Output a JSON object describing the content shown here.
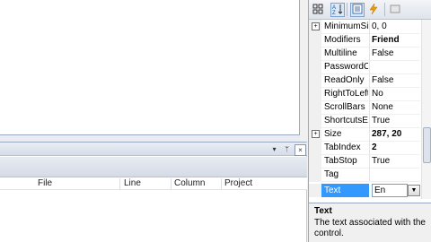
{
  "designer": {},
  "error_list": {
    "columns": [
      "File",
      "Line",
      "Column",
      "Project"
    ],
    "title_buttons": {
      "dropdown": "▾",
      "pin": "ᛘ",
      "close": "×"
    }
  },
  "properties": {
    "toolbar_icons": [
      "categorized-icon",
      "alphabetical-icon",
      "properties-icon",
      "events-icon",
      "property-pages-icon"
    ],
    "rows": [
      {
        "name": "MinimumSi",
        "value": "0, 0",
        "expandable": true,
        "bold": false
      },
      {
        "name": "Modifiers",
        "value": "Friend",
        "expandable": false,
        "bold": true
      },
      {
        "name": "Multiline",
        "value": "False",
        "expandable": false,
        "bold": false
      },
      {
        "name": "PasswordC",
        "value": "",
        "expandable": false,
        "bold": false
      },
      {
        "name": "ReadOnly",
        "value": "False",
        "expandable": false,
        "bold": false
      },
      {
        "name": "RightToLeft",
        "value": "No",
        "expandable": false,
        "bold": false
      },
      {
        "name": "ScrollBars",
        "value": "None",
        "expandable": false,
        "bold": false
      },
      {
        "name": "ShortcutsEr",
        "value": "True",
        "expandable": false,
        "bold": false
      },
      {
        "name": "Size",
        "value": "287, 20",
        "expandable": true,
        "bold": true
      },
      {
        "name": "TabIndex",
        "value": "2",
        "expandable": false,
        "bold": true
      },
      {
        "name": "TabStop",
        "value": "True",
        "expandable": false,
        "bold": false
      },
      {
        "name": "Tag",
        "value": "",
        "expandable": false,
        "bold": false
      }
    ],
    "selected": {
      "name": "Text",
      "value": "En"
    },
    "description": {
      "title": "Text",
      "text": "The text associated with the control."
    }
  }
}
